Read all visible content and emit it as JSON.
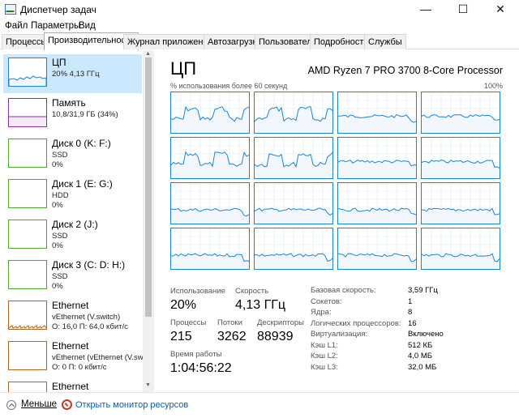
{
  "window": {
    "title": "Диспетчер задач",
    "minimize": "—",
    "maximize": "☐",
    "close": "✕"
  },
  "menu": [
    "Файл",
    "Параметры",
    "Вид"
  ],
  "tabs": [
    "Процессы",
    "Производительность",
    "Журнал приложений",
    "Автозагрузка",
    "Пользователи",
    "Подробности",
    "Службы"
  ],
  "active_tab": 1,
  "sidebar": {
    "items": [
      {
        "name": "ЦП",
        "sub1": "20% 4,13 ГГц",
        "sub2": "",
        "sub3": "",
        "color": "#1a85d6",
        "active": true
      },
      {
        "name": "Память",
        "sub1": "10,8/31,9 ГБ (34%)",
        "sub2": "",
        "sub3": "",
        "color": "#8e2ea3",
        "active": false
      },
      {
        "name": "Диск 0 (K: F:)",
        "sub1": "SSD",
        "sub2": "0%",
        "sub3": "",
        "color": "#4ca72a",
        "active": false
      },
      {
        "name": "Диск 1 (E: G:)",
        "sub1": "HDD",
        "sub2": "0%",
        "sub3": "",
        "color": "#4ca72a",
        "active": false
      },
      {
        "name": "Диск 2 (J:)",
        "sub1": "SSD",
        "sub2": "0%",
        "sub3": "",
        "color": "#4ca72a",
        "active": false
      },
      {
        "name": "Диск 3 (C: D: H:)",
        "sub1": "SSD",
        "sub2": "0%",
        "sub3": "",
        "color": "#4ca72a",
        "active": false
      },
      {
        "name": "Ethernet",
        "sub1": "vEthernet (V.switch)",
        "sub2": "О: 16,0 П: 64,0 кбит/с",
        "sub3": "",
        "color": "#b5651d",
        "active": false
      },
      {
        "name": "Ethernet",
        "sub1": "vEthernet (vEthernet (V.sw)",
        "sub2": "О: 0 П: 0 кбит/с",
        "sub3": "",
        "color": "#b5651d",
        "active": false
      },
      {
        "name": "Ethernet",
        "sub1": "",
        "sub2": "",
        "sub3": "",
        "color": "#b5651d",
        "active": false
      }
    ]
  },
  "cpu": {
    "title": "ЦП",
    "model": "AMD Ryzen 7 PRO 3700 8-Core Processor",
    "util_label": "% использования более 60 секунд",
    "max_label": "100%",
    "stats": {
      "usage_label": "Использование",
      "usage_value": "20%",
      "speed_label": "Скорость",
      "speed_value": "4,13 ГГц",
      "processes_label": "Процессы",
      "processes_value": "215",
      "threads_label": "Потоки",
      "threads_value": "3262",
      "handles_label": "Дескрипторы",
      "handles_value": "88939",
      "uptime_label": "Время работы",
      "uptime_value": "1:04:56:22"
    },
    "specs": [
      {
        "label": "Базовая скорость:",
        "value": "3,59 ГГц"
      },
      {
        "label": "Сокетов:",
        "value": "1"
      },
      {
        "label": "Ядра:",
        "value": "8"
      },
      {
        "label": "Логических процессоров:",
        "value": "16"
      },
      {
        "label": "Виртуализация:",
        "value": "Включено"
      },
      {
        "label": "Кэш L1:",
        "value": "512 КБ"
      },
      {
        "label": "Кэш L2:",
        "value": "4,0 МБ"
      },
      {
        "label": "Кэш L3:",
        "value": "32,0 МБ"
      }
    ]
  },
  "footer": {
    "less": "Меньше",
    "resmon": "Открыть монитор ресурсов"
  },
  "icons": {
    "app": "task-manager-icon",
    "less": "chevron-up-circle-icon",
    "resmon": "resource-monitor-icon"
  },
  "colors": {
    "cpu_line": "#1a85d6",
    "cpu_fill": "#f1f7fd",
    "active_item": "#cce8ff"
  }
}
